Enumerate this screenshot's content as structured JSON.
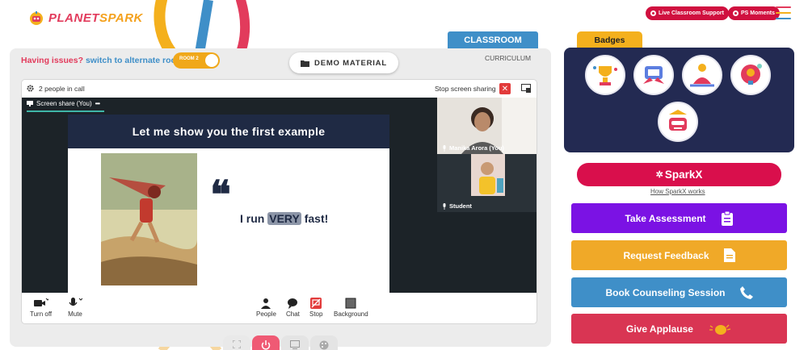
{
  "header": {
    "logo_text_a": "PLANET",
    "logo_text_b": "SPARK",
    "live_support_label": "Live Classroom Support",
    "moments_label": "PS Moments",
    "menu_icon": "hamburger-icon"
  },
  "tabs": {
    "classroom": "CLASSROOM",
    "curriculum": "CURRICULUM"
  },
  "issues": {
    "question": "Having issues?",
    "link": "switch to alternate room",
    "room_label": "ROOM 2"
  },
  "demo_material": "DEMO MATERIAL",
  "call": {
    "people_count": "2 people in call",
    "stop_sharing": "Stop screen sharing",
    "screen_share_tab": "Screen share (You)",
    "tab_more": "•••",
    "slide_title": "Let me show you the first example",
    "quote_mark": "❝",
    "phrase_before": "I run ",
    "phrase_highlight": "VERY",
    "phrase_after": " fast!",
    "tiles": [
      {
        "name": "Manika Arora (You)"
      },
      {
        "name": "Student"
      }
    ],
    "toolbar": {
      "turn_off": "Turn off",
      "mute": "Mute",
      "people": "People",
      "chat": "Chat",
      "stop": "Stop",
      "background": "Background"
    }
  },
  "right": {
    "badges_title": "Badges",
    "sparkx_label": "SparkX",
    "how_works": "How SparkX works",
    "actions": [
      {
        "label": "Take Assessment",
        "color": "#7b12e4",
        "icon": "clipboard-icon"
      },
      {
        "label": "Request Feedback",
        "color": "#f0a928",
        "icon": "document-icon"
      },
      {
        "label": "Book Counseling Session",
        "color": "#3f8fc8",
        "icon": "phone-icon"
      },
      {
        "label": "Give Applause",
        "color": "#d93553",
        "icon": "clap-icon"
      }
    ]
  },
  "colors": {
    "brand_red": "#e23b5c",
    "brand_blue": "#3f8fc8",
    "brand_yellow": "#f4b01d",
    "panel_navy": "#232a52"
  }
}
